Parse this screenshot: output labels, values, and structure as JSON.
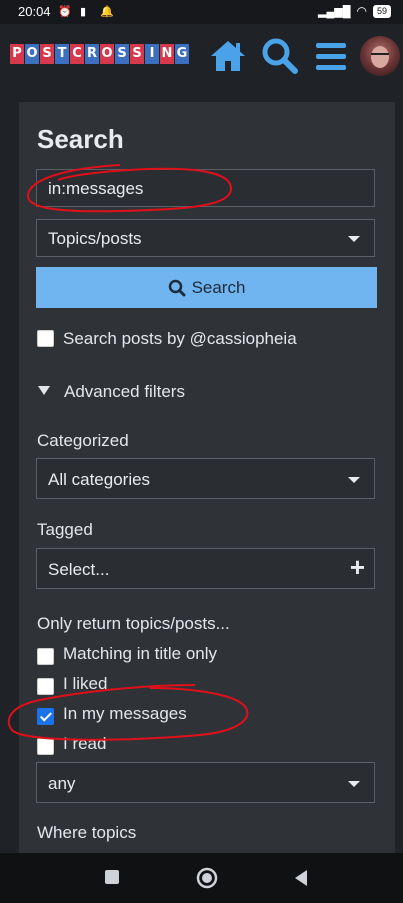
{
  "status_bar": {
    "time": "20:04",
    "battery": "59",
    "icons": [
      "alarm-icon",
      "sim-icon",
      "notification-bell-icon",
      "signal-icon",
      "wifi-icon",
      "battery-icon"
    ]
  },
  "header": {
    "logo_letters": [
      "P",
      "O",
      "S",
      "T",
      "C",
      "R",
      "O",
      "S",
      "S",
      "I",
      "N",
      "G"
    ],
    "icons": [
      "home-icon",
      "search-icon",
      "menu-icon"
    ],
    "colors": {
      "logo_red": "#d6394b",
      "logo_blue": "#3d6fc1",
      "icon_blue": "#4aa3e8"
    }
  },
  "search": {
    "title": "Search",
    "query_value": "in:messages",
    "type_select": "Topics/posts",
    "search_button": "Search",
    "search_posts_by": "Search posts by @cassiopheia",
    "advanced_filters": "Advanced filters",
    "categorized_label": "Categorized",
    "category_select": "All categories",
    "tagged_label": "Tagged",
    "tags_select": "Select...",
    "only_return_label": "Only return topics/posts...",
    "options": [
      {
        "label": "Matching in title only",
        "checked": false
      },
      {
        "label": "I liked",
        "checked": false
      },
      {
        "label": "In my messages",
        "checked": true
      },
      {
        "label": "I read",
        "checked": false
      }
    ],
    "any_select": "any",
    "where_topics_label": "Where topics",
    "colors": {
      "search_button": "#70b4f0",
      "annotation": "#e0101a"
    }
  },
  "nav_bar": {
    "icons": [
      "recents-square-icon",
      "home-circle-icon",
      "back-triangle-icon"
    ]
  }
}
